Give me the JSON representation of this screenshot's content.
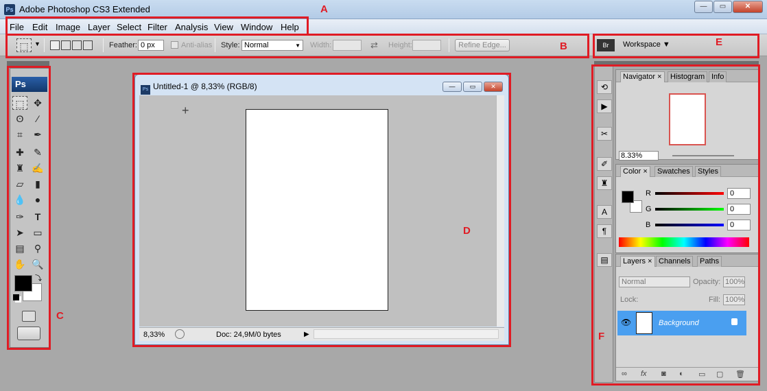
{
  "window": {
    "title": "Adobe Photoshop CS3 Extended",
    "app_icon": "Ps",
    "btn_minimize": "—",
    "btn_maximize": "▭",
    "btn_close": "✕"
  },
  "menu": [
    "File",
    "Edit",
    "Image",
    "Layer",
    "Select",
    "Filter",
    "Analysis",
    "View",
    "Window",
    "Help"
  ],
  "options": {
    "feather_label": "Feather:",
    "feather_value": "0 px",
    "antialias_label": "Anti-alias",
    "style_label": "Style:",
    "style_value": "Normal",
    "width_label": "Width:",
    "height_label": "Height:",
    "refine_edge": "Refine Edge..."
  },
  "workspace": {
    "label": "Workspace ▼",
    "icon": "Br"
  },
  "toolbox": {
    "badge": "Ps"
  },
  "document": {
    "title": "Untitled-1 @ 8,33% (RGB/8)",
    "icon": "Ps",
    "zoom": "8,33%",
    "doc_info": "Doc: 24,9M/0 bytes"
  },
  "navigator": {
    "tabs": [
      "Navigator ×",
      "Histogram",
      "Info"
    ],
    "zoom": "8.33%"
  },
  "color": {
    "tabs": [
      "Color ×",
      "Swatches",
      "Styles"
    ],
    "r_label": "R",
    "g_label": "G",
    "b_label": "B",
    "r": "0",
    "g": "0",
    "b": "0"
  },
  "layers": {
    "tabs": [
      "Layers ×",
      "Channels",
      "Paths"
    ],
    "blend": "Normal",
    "opacity_label": "Opacity:",
    "opacity": "100%",
    "lock_label": "Lock:",
    "fill_label": "Fill:",
    "fill": "100%",
    "layer_name": "Background"
  },
  "annotations": [
    "A",
    "B",
    "C",
    "D",
    "E",
    "F"
  ]
}
